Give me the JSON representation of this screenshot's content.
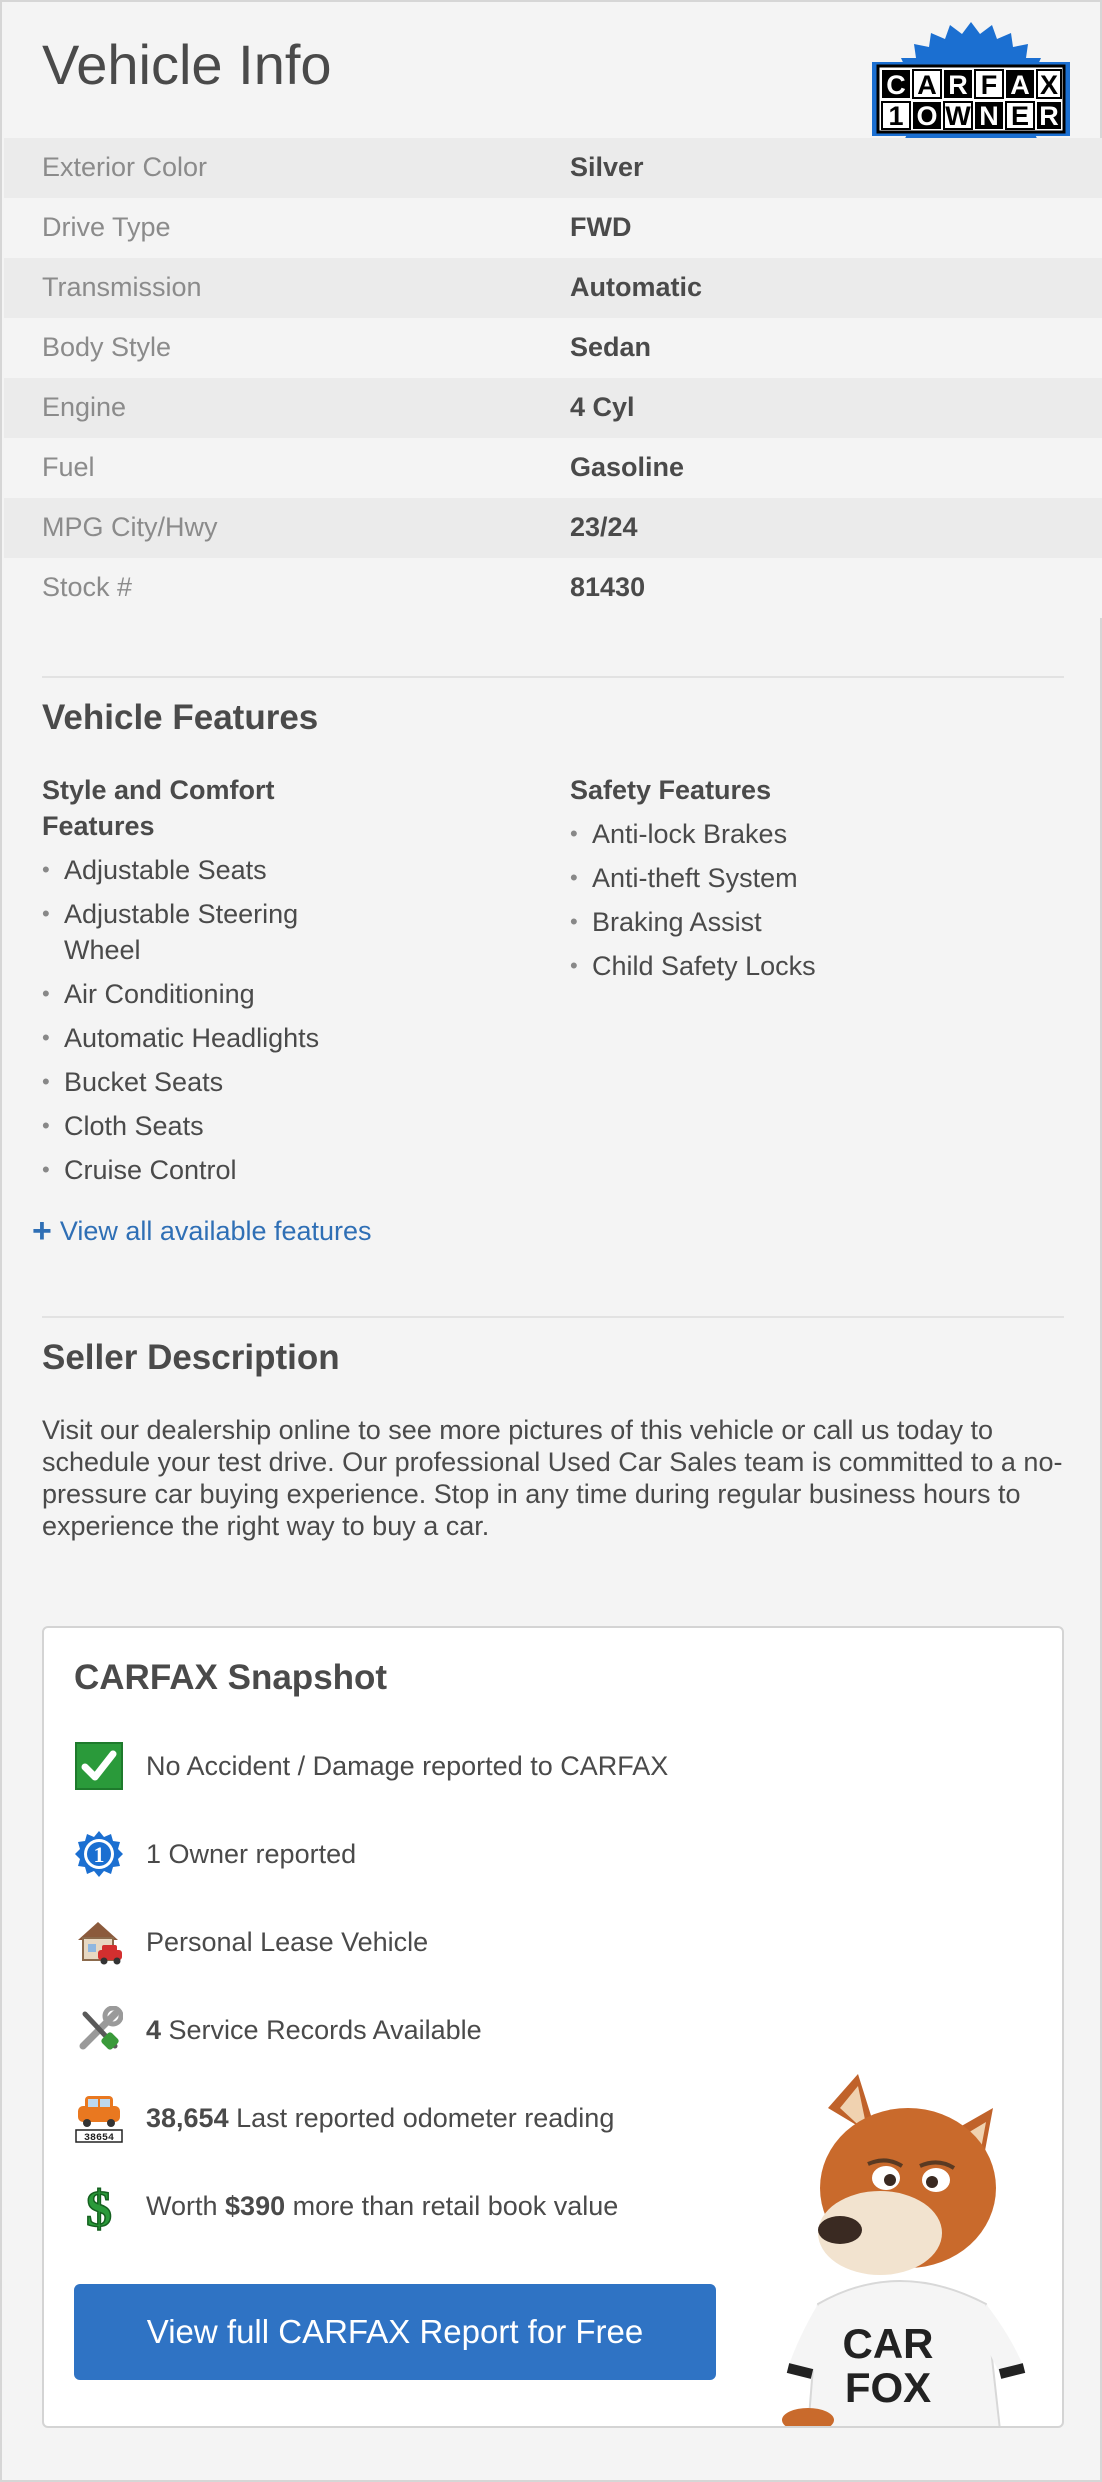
{
  "header": {
    "title": "Vehicle Info",
    "badge": {
      "line1": "CARFAX",
      "line2": "1OWNER"
    }
  },
  "specs": [
    {
      "label": "Exterior Color",
      "value": "Silver"
    },
    {
      "label": "Drive Type",
      "value": "FWD"
    },
    {
      "label": "Transmission",
      "value": "Automatic"
    },
    {
      "label": "Body Style",
      "value": "Sedan"
    },
    {
      "label": "Engine",
      "value": "4 Cyl"
    },
    {
      "label": "Fuel",
      "value": "Gasoline"
    },
    {
      "label": "MPG City/Hwy",
      "value": "23/24"
    },
    {
      "label": "Stock #",
      "value": "81430"
    }
  ],
  "features": {
    "heading": "Vehicle Features",
    "comfort": {
      "heading_line1": "Style and Comfort",
      "heading_line2": "Features",
      "items": [
        "Adjustable Seats",
        "Adjustable Steering Wheel",
        "Air Conditioning",
        "Automatic Headlights",
        "Bucket Seats",
        "Cloth Seats",
        "Cruise Control"
      ]
    },
    "safety": {
      "heading": "Safety Features",
      "items": [
        "Anti-lock Brakes",
        "Anti-theft System",
        "Braking Assist",
        "Child Safety Locks"
      ]
    },
    "view_all": {
      "icon": "plus-icon",
      "label": "View all available features"
    }
  },
  "seller": {
    "heading": "Seller Description",
    "text": "Visit our dealership online to see more pictures of this vehicle or call us today to schedule your test drive. Our professional Used Car Sales team is committed to a no-pressure car buying experience. Stop in any time during regular business hours to experience the right way to buy a car."
  },
  "snapshot": {
    "title": "CARFAX Snapshot",
    "rows": [
      {
        "icon": "checkmark-icon",
        "bold": "",
        "text": "No Accident / Damage reported to CARFAX"
      },
      {
        "icon": "one-owner-icon",
        "bold": "",
        "text": "1 Owner reported"
      },
      {
        "icon": "house-car-icon",
        "bold": "",
        "text": "Personal Lease Vehicle"
      },
      {
        "icon": "tools-icon",
        "bold": "4",
        "text": " Service Records Available"
      },
      {
        "icon": "odometer-car-icon",
        "bold": "38,654",
        "text": " Last reported odometer reading"
      },
      {
        "icon": "dollar-icon",
        "pre": "Worth ",
        "bold": "$390",
        "text": " more than retail book value"
      }
    ],
    "odometer_digits": "38654",
    "cta_label": "View full CARFAX Report for Free",
    "mascot_shirt": {
      "line1": "CAR",
      "line2": "FOX"
    }
  },
  "colors": {
    "accent_blue": "#2f73c4",
    "link_blue": "#2f6fb5",
    "check_green": "#2a9a3a",
    "badge_blue": "#1b6fd1"
  }
}
